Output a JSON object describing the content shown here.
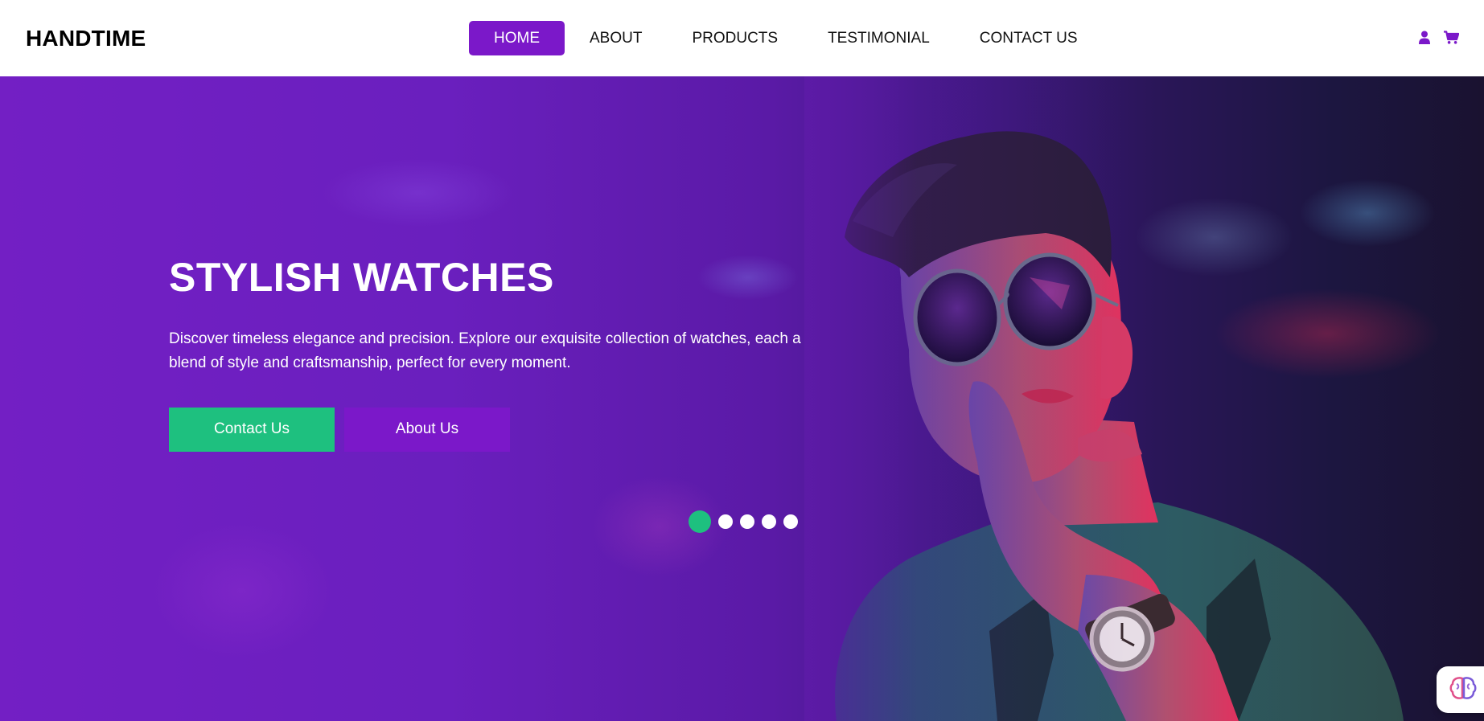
{
  "brand": {
    "name": "HANDTIME"
  },
  "nav": {
    "items": [
      {
        "label": "HOME",
        "active": true
      },
      {
        "label": "ABOUT",
        "active": false
      },
      {
        "label": "PRODUCTS",
        "active": false
      },
      {
        "label": "TESTIMONIAL",
        "active": false
      },
      {
        "label": "CONTACT US",
        "active": false
      }
    ]
  },
  "header_icons": [
    "user-icon",
    "cart-icon"
  ],
  "hero": {
    "title": "STYLISH WATCHES",
    "description": "Discover timeless elegance and precision. Explore our exquisite collection of watches, each a blend of style and craftsmanship, perfect for every moment.",
    "buttons": {
      "contact": "Contact Us",
      "about": "About Us"
    },
    "slides": {
      "count": 5,
      "active_index": 0
    }
  },
  "colors": {
    "accent_purple": "#7b18c9",
    "accent_green": "#1ec07f",
    "text_dark": "#111111"
  },
  "widget": {
    "icon": "brain-assistant-icon"
  }
}
